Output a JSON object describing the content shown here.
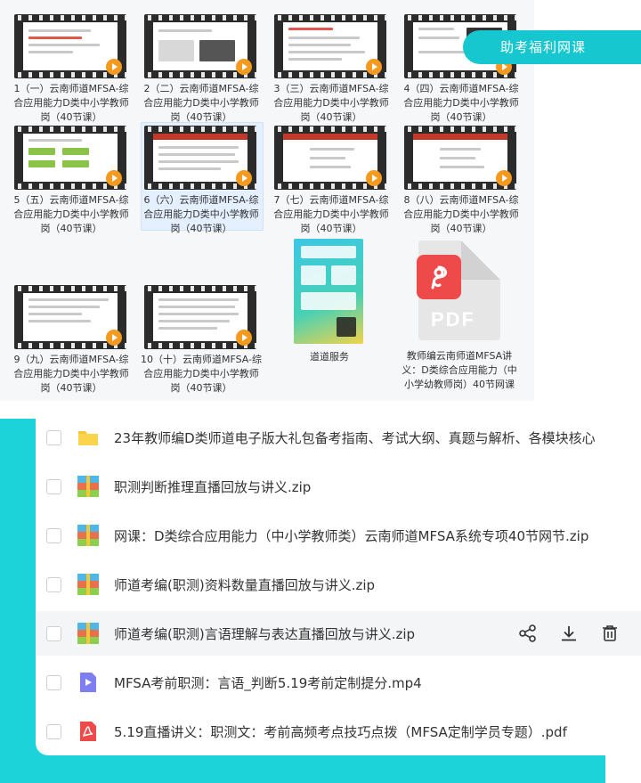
{
  "thumbnails": [
    {
      "label": "1（一）云南师道MFSA-综合应用能力D类中小学教师岗（40节课）"
    },
    {
      "label": "2（二）云南师道MFSA-综合应用能力D类中小学教师岗（40节课）"
    },
    {
      "label": "3（三）云南师道MFSA-综合应用能力D类中小学教师岗（40节课）"
    },
    {
      "label": "4（四）云南师道MFSA-综合应用能力D类中小学教师岗（40节课）"
    },
    {
      "label": "5（五）云南师道MFSA-综合应用能力D类中小学教师岗（40节课）"
    },
    {
      "label": "6（六）云南师道MFSA-综合应用能力D类中小学教师岗（40节课）"
    },
    {
      "label": "7（七）云南师道MFSA-综合应用能力D类中小学教师岗（40节课）"
    },
    {
      "label": "8（八）云南师道MFSA-综合应用能力D类中小学教师岗（40节课）"
    },
    {
      "label": "9（九）云南师道MFSA-综合应用能力D类中小学教师岗（40节课）"
    },
    {
      "label": "10（十）云南师道MFSA-综合应用能力D类中小学教师岗（40节课）"
    }
  ],
  "poster": {
    "label": "道道服务"
  },
  "pdf_file": {
    "badge_text": "PDF",
    "label": "教师编云南师道MFSA讲义：D类综合应用能力（中小学幼教师岗）40节网课"
  },
  "promo": {
    "label": "助考福利网课"
  },
  "files": [
    {
      "icon": "folder-icon",
      "name": "23年教师编D类师道电子版大礼包备考指南、考试大纲、真题与解析、各模块核心"
    },
    {
      "icon": "zip-icon",
      "name": "职测判断推理直播回放与讲义.zip"
    },
    {
      "icon": "zip-icon",
      "name": "网课：D类综合应用能力（中小学教师类）云南师道MFSA系统专项40节网节.zip"
    },
    {
      "icon": "zip-icon",
      "name": "师道考编(职测)资料数量直播回放与讲义.zip"
    },
    {
      "icon": "zip-icon",
      "name": "师道考编(职测)言语理解与表达直播回放与讲义.zip"
    },
    {
      "icon": "video-icon",
      "name": "MFSA考前职测：言语_判断5.19考前定制提分.mp4"
    },
    {
      "icon": "pdf-icon",
      "name": "5.19直播讲义：职测文：考前高频考点技巧点拨（MFSA定制学员专题）.pdf"
    }
  ],
  "colors": {
    "accent_cyan": "#1bd3d8",
    "promo": "#17c7cf",
    "pdf_red": "#ef4a4a",
    "play_orange": "#f39a1f",
    "folder_yellow": "#f7c637"
  }
}
